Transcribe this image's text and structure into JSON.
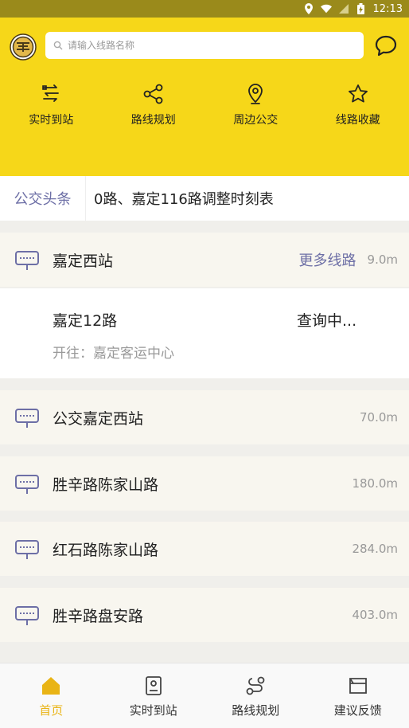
{
  "status_bar": {
    "time": "12:13"
  },
  "header": {
    "search_placeholder": "请输入线路名称"
  },
  "quick_actions": [
    {
      "label": "实时到站",
      "icon": "realtime-icon"
    },
    {
      "label": "路线规划",
      "icon": "route-plan-icon"
    },
    {
      "label": "周边公交",
      "icon": "location-pin-icon"
    },
    {
      "label": "线路收藏",
      "icon": "star-icon"
    }
  ],
  "news": {
    "tag": "公交头条",
    "text": "0路、嘉定116路调整时刻表"
  },
  "nearby": {
    "first_station": {
      "name": "嘉定西站",
      "more_label": "更多线路",
      "distance": "9.0m",
      "route": {
        "name": "嘉定12路",
        "status": "查询中...",
        "direction": "开往：嘉定客运中心"
      }
    },
    "stations": [
      {
        "name": "公交嘉定西站",
        "distance": "70.0m"
      },
      {
        "name": "胜辛路陈家山路",
        "distance": "180.0m"
      },
      {
        "name": "红石路陈家山路",
        "distance": "284.0m"
      },
      {
        "name": "胜辛路盘安路",
        "distance": "403.0m"
      }
    ]
  },
  "tabs": [
    {
      "label": "首页",
      "active": true
    },
    {
      "label": "实时到站",
      "active": false
    },
    {
      "label": "路线规划",
      "active": false
    },
    {
      "label": "建议反馈",
      "active": false
    }
  ],
  "colors": {
    "brand_yellow": "#f6d719",
    "accent_purple": "#6d6fa6",
    "active_tab": "#e9b415"
  }
}
